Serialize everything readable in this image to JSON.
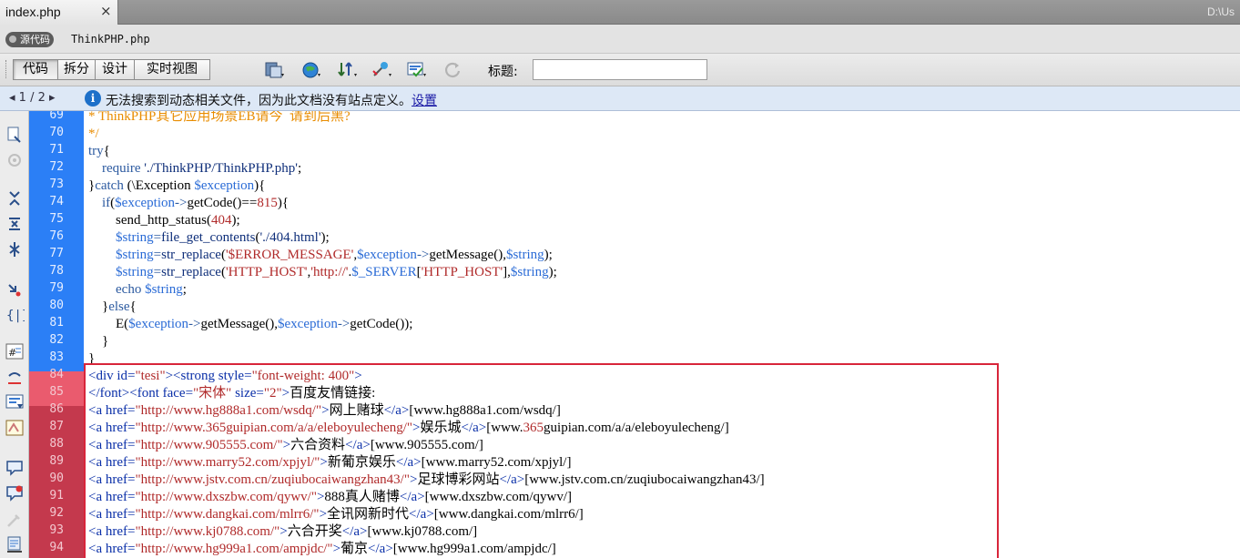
{
  "tab": {
    "title": "index.php",
    "close": "×",
    "path": "D:\\Us"
  },
  "related_files": {
    "source_badge": "源代码",
    "file": "ThinkPHP.php"
  },
  "toolbar": {
    "views": [
      "代码",
      "拆分",
      "设计",
      "实时视图"
    ],
    "active_view": "代码",
    "icons": [
      "file-management-icon",
      "preview-browser-icon",
      "debug-icon",
      "visual-aids-icon",
      "validate-icon",
      "refresh-icon"
    ],
    "title_label": "标题:",
    "title_value": ""
  },
  "infobar": {
    "pager_prev": "◂",
    "pager_text": "1 / 2",
    "pager_next": "▸",
    "message": "无法搜索到动态相关文件，因为此文档没有站点定义。",
    "link": "设置"
  },
  "colors": {
    "gutter": "#2b7ff6",
    "gutter_marked": "#c4394d",
    "highlight_box": "#d8253a",
    "infobar": "#dde8f6"
  },
  "code": {
    "line_numbers": [
      "69",
      "70",
      "71",
      "72",
      "73",
      "74",
      "75",
      "76",
      "77",
      "78",
      "79",
      "80",
      "81",
      "82",
      "83",
      "84",
      "85",
      "86",
      "87",
      "88",
      "89",
      "90",
      "91",
      "92",
      "93",
      "94"
    ],
    "marked_from": "84",
    "lines": [
      [
        [
          "c-com",
          "* ThinkPHP其它应用场景EB请今  请到后黑?"
        ]
      ],
      [
        [
          "c-com",
          "*/"
        ]
      ],
      [
        [
          "c-kw",
          "try"
        ],
        [
          "c-txt",
          "{"
        ]
      ],
      [
        [
          "c-txt",
          "    "
        ],
        [
          "c-kw",
          "require"
        ],
        [
          "c-txt",
          " "
        ],
        [
          "c-fn",
          "'./ThinkPHP/ThinkPHP.php'"
        ],
        [
          "c-txt",
          ";"
        ]
      ],
      [
        [
          "c-txt",
          "}"
        ],
        [
          "c-kw",
          "catch"
        ],
        [
          "c-txt",
          " (\\Exception "
        ],
        [
          "c-var",
          "$exception"
        ],
        [
          "c-txt",
          "){"
        ]
      ],
      [
        [
          "c-txt",
          "    "
        ],
        [
          "c-kw",
          "if"
        ],
        [
          "c-txt",
          "("
        ],
        [
          "c-var",
          "$exception"
        ],
        [
          "c-kw",
          "->"
        ],
        [
          "c-txt",
          "getCode()=="
        ],
        [
          "c-str",
          "815"
        ],
        [
          "c-txt",
          "){"
        ]
      ],
      [
        [
          "c-txt",
          "        send_http_status("
        ],
        [
          "c-str",
          "404"
        ],
        [
          "c-txt",
          ");"
        ]
      ],
      [
        [
          "c-txt",
          "        "
        ],
        [
          "c-var",
          "$string"
        ],
        [
          "c-kw",
          "="
        ],
        [
          "c-fn",
          "file_get_contents"
        ],
        [
          "c-txt",
          "("
        ],
        [
          "c-fn",
          "'./404.html'"
        ],
        [
          "c-txt",
          ");"
        ]
      ],
      [
        [
          "c-txt",
          "        "
        ],
        [
          "c-var",
          "$string"
        ],
        [
          "c-kw",
          "="
        ],
        [
          "c-fn",
          "str_replace"
        ],
        [
          "c-txt",
          "("
        ],
        [
          "c-str",
          "'$ERROR_MESSAGE'"
        ],
        [
          "c-txt",
          ","
        ],
        [
          "c-var",
          "$exception"
        ],
        [
          "c-kw",
          "->"
        ],
        [
          "c-txt",
          "getMessage(),"
        ],
        [
          "c-var",
          "$string"
        ],
        [
          "c-txt",
          ");"
        ]
      ],
      [
        [
          "c-txt",
          "        "
        ],
        [
          "c-var",
          "$string"
        ],
        [
          "c-kw",
          "="
        ],
        [
          "c-fn",
          "str_replace"
        ],
        [
          "c-txt",
          "("
        ],
        [
          "c-str",
          "'HTTP_HOST'"
        ],
        [
          "c-txt",
          ","
        ],
        [
          "c-str",
          "'http://'"
        ],
        [
          "c-txt",
          "."
        ],
        [
          "c-var",
          "$_SERVER"
        ],
        [
          "c-txt",
          "["
        ],
        [
          "c-str",
          "'HTTP_HOST'"
        ],
        [
          "c-txt",
          "],"
        ],
        [
          "c-var",
          "$string"
        ],
        [
          "c-txt",
          ");"
        ]
      ],
      [
        [
          "c-txt",
          "        "
        ],
        [
          "c-kw",
          "echo"
        ],
        [
          "c-txt",
          " "
        ],
        [
          "c-var",
          "$string"
        ],
        [
          "c-txt",
          ";"
        ]
      ],
      [
        [
          "c-txt",
          "    }"
        ],
        [
          "c-kw",
          "else"
        ],
        [
          "c-txt",
          "{"
        ]
      ],
      [
        [
          "c-txt",
          "        E("
        ],
        [
          "c-var",
          "$exception"
        ],
        [
          "c-kw",
          "->"
        ],
        [
          "c-txt",
          "getMessage(),"
        ],
        [
          "c-var",
          "$exception"
        ],
        [
          "c-kw",
          "->"
        ],
        [
          "c-txt",
          "getCode());"
        ]
      ],
      [
        [
          "c-txt",
          "    }"
        ]
      ],
      [
        [
          "c-txt",
          "}"
        ]
      ],
      [
        [
          "c-tag",
          "<div id="
        ],
        [
          "c-str",
          "\"tesi\""
        ],
        [
          "c-tag",
          "><strong style="
        ],
        [
          "c-str",
          "\"font-weight: 400\""
        ],
        [
          "c-tag",
          ">"
        ]
      ],
      [
        [
          "c-tag",
          "</font><font face="
        ],
        [
          "c-str",
          "\"宋体\""
        ],
        [
          "c-tag",
          " size="
        ],
        [
          "c-str",
          "\"2\""
        ],
        [
          "c-tag",
          ">"
        ],
        [
          "c-txt",
          "百度友情链接:"
        ]
      ],
      [
        [
          "c-tag",
          "<a href="
        ],
        [
          "c-str",
          "\"http://www.hg888a1.com/wsdq/\""
        ],
        [
          "c-tag",
          ">"
        ],
        [
          "c-txt",
          "网上赌球"
        ],
        [
          "c-tag",
          "</a>"
        ],
        [
          "c-txt",
          "[www.hg888a1.com/wsdq/]"
        ]
      ],
      [
        [
          "c-tag",
          "<a href="
        ],
        [
          "c-str",
          "\"http://www.365guipian.com/a/a/eleboyulecheng/\""
        ],
        [
          "c-tag",
          ">"
        ],
        [
          "c-txt",
          "娱乐城"
        ],
        [
          "c-tag",
          "</a>"
        ],
        [
          "c-txt",
          "[www."
        ],
        [
          "c-str",
          "365"
        ],
        [
          "c-txt",
          "guipian.com/a/a/eleboyulecheng/]"
        ]
      ],
      [
        [
          "c-tag",
          "<a href="
        ],
        [
          "c-str",
          "\"http://www.905555.com/\""
        ],
        [
          "c-tag",
          ">"
        ],
        [
          "c-txt",
          "六合资料"
        ],
        [
          "c-tag",
          "</a>"
        ],
        [
          "c-txt",
          "[www.905555.com/]"
        ]
      ],
      [
        [
          "c-tag",
          "<a href="
        ],
        [
          "c-str",
          "\"http://www.marry52.com/xpjyl/\""
        ],
        [
          "c-tag",
          ">"
        ],
        [
          "c-txt",
          "新葡京娱乐"
        ],
        [
          "c-tag",
          "</a>"
        ],
        [
          "c-txt",
          "[www.marry52.com/xpjyl/]"
        ]
      ],
      [
        [
          "c-tag",
          "<a href="
        ],
        [
          "c-str",
          "\"http://www.jstv.com.cn/zuqiubocaiwangzhan43/\""
        ],
        [
          "c-tag",
          ">"
        ],
        [
          "c-txt",
          "足球博彩网站"
        ],
        [
          "c-tag",
          "</a>"
        ],
        [
          "c-txt",
          "[www.jstv.com.cn/zuqiubocaiwangzhan43/]"
        ]
      ],
      [
        [
          "c-tag",
          "<a href="
        ],
        [
          "c-str",
          "\"http://www.dxszbw.com/qywv/\""
        ],
        [
          "c-tag",
          ">"
        ],
        [
          "c-txt",
          "888真人赌博"
        ],
        [
          "c-tag",
          "</a>"
        ],
        [
          "c-txt",
          "[www.dxszbw.com/qywv/]"
        ]
      ],
      [
        [
          "c-tag",
          "<a href="
        ],
        [
          "c-str",
          "\"http://www.dangkai.com/mlrr6/\""
        ],
        [
          "c-tag",
          ">"
        ],
        [
          "c-txt",
          "全讯网新时代"
        ],
        [
          "c-tag",
          "</a>"
        ],
        [
          "c-txt",
          "[www.dangkai.com/mlrr6/]"
        ]
      ],
      [
        [
          "c-tag",
          "<a href="
        ],
        [
          "c-str",
          "\"http://www.kj0788.com/\""
        ],
        [
          "c-tag",
          ">"
        ],
        [
          "c-txt",
          "六合开奖"
        ],
        [
          "c-tag",
          "</a>"
        ],
        [
          "c-txt",
          "[www.kj0788.com/]"
        ]
      ],
      [
        [
          "c-tag",
          "<a href="
        ],
        [
          "c-str",
          "\"http://www.hg999a1.com/ampjdc/\""
        ],
        [
          "c-tag",
          ">"
        ],
        [
          "c-txt",
          "葡京"
        ],
        [
          "c-tag",
          "</a>"
        ],
        [
          "c-txt",
          "[www.hg999a1.com/ampjdc/]"
        ]
      ]
    ]
  }
}
